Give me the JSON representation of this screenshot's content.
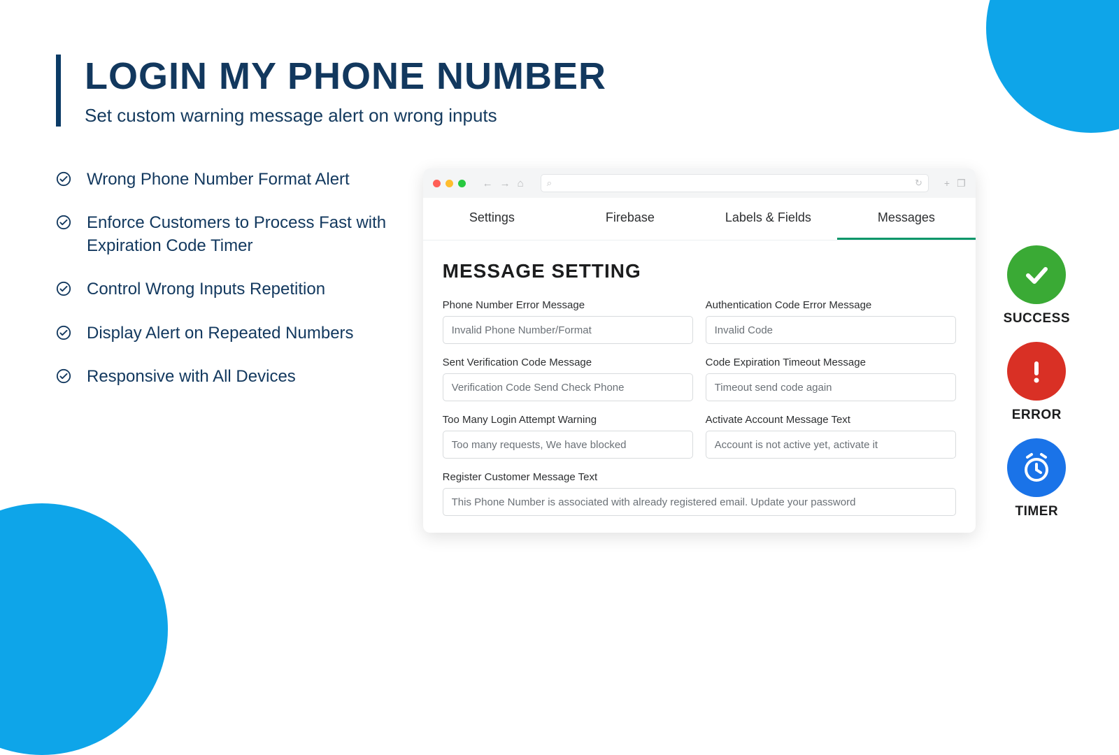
{
  "header": {
    "title": "LOGIN MY PHONE NUMBER",
    "subtitle": "Set custom warning message alert on wrong inputs"
  },
  "features": [
    "Wrong Phone Number Format Alert",
    "Enforce Customers to Process Fast with Expiration Code Timer",
    "Control Wrong Inputs Repetition",
    "Display Alert on Repeated Numbers",
    "Responsive with All Devices"
  ],
  "browser": {
    "tabs": [
      "Settings",
      "Firebase",
      "Labels & Fields",
      "Messages"
    ],
    "active_tab": 3,
    "panel_title": "MESSAGE SETTING",
    "fields": {
      "phone_error": {
        "label": "Phone Number Error Message",
        "value": "Invalid Phone Number/Format"
      },
      "auth_error": {
        "label": "Authentication Code Error Message",
        "value": "Invalid Code"
      },
      "sent_verification": {
        "label": "Sent Verification Code Message",
        "value": "Verification Code Send Check Phone"
      },
      "timeout": {
        "label": "Code Expiration Timeout Message",
        "value": "Timeout send code again"
      },
      "too_many": {
        "label": "Too Many Login Attempt Warning",
        "value": "Too many requests, We have blocked"
      },
      "activate": {
        "label": "Activate Account Message Text",
        "value": "Account is not active yet, activate it"
      },
      "register": {
        "label": "Register Customer Message Text",
        "value": "This Phone Number is associated with already registered email. Update your password"
      }
    }
  },
  "badges": {
    "success": "SUCCESS",
    "error": "ERROR",
    "timer": "TIMER"
  },
  "colors": {
    "brand_dark": "#12385e",
    "accent_blue": "#0ea5e9",
    "tab_active": "#059669",
    "success": "#3aaa35",
    "error": "#d93025",
    "timer": "#1a73e8"
  }
}
